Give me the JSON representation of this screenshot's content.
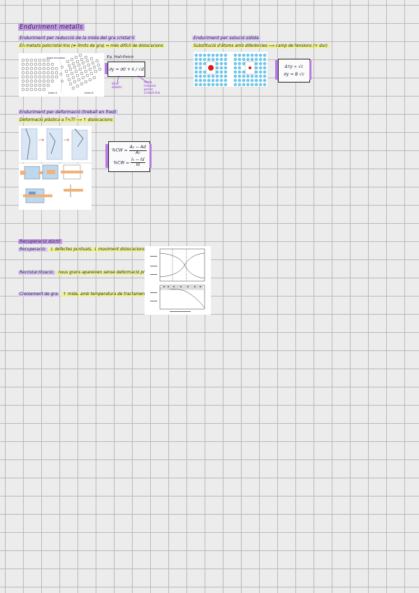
{
  "page": {
    "title": "Enduriment metalls"
  },
  "section1": {
    "heading": "Enduriment per reducció de la mida del gra cristal·lí",
    "subline": "En metalls policristal·lins (≠ límits de gra) ⇒ més difícil de dislocacions",
    "equation_label": "Eq. Hall-Petch",
    "equation": "σy = σ0 + k / √d",
    "note_left": "límit elàstic",
    "note_right": "mida mitjana grans cristal·lins",
    "figure_labels": {
      "top": "Grain boundary",
      "left": "Grain A",
      "right": "Grain B"
    }
  },
  "section2": {
    "heading": "Enduriment per solució sòlida",
    "subline": "Substitució d'àtoms amb diferències ⟶ camp de tensions (+ dur)",
    "formula1": "Δτy ∝ √c",
    "formula2": "σy = B √c"
  },
  "section3": {
    "heading": "Enduriment per deformació (treball en fred)",
    "subline": "Deformació plàstica a T<Tf ⟶ ↑ dislocacions",
    "cw1_lhs": "%CW =",
    "cw1_num": "A₀ − Ad",
    "cw1_den": "A₀",
    "cw2_lhs": "%CW =",
    "cw2_num": "l₀ − ld",
    "cw2_den": "ld"
  },
  "section4": {
    "heading": "Recuperació dúctil",
    "item1_label": "Recuperació:",
    "item1_text": "↓ defectes puntuals, ↓ moviment dislocacions",
    "item2_label": "Recristal·lització:",
    "item2_text": "nous grans apareixen sense deformació plàstica",
    "item3_label": "Creixement de gra:",
    "item3_text": "↑ mida, amb temperatura de tractament"
  },
  "colors": {
    "title_highlight": "#c59de6",
    "heading_highlight": "#d9c6f2",
    "subline_highlight": "#eef28a",
    "annotation": "#8a2bd6",
    "lattice_atom": "#6fc6ea",
    "solute_atom": "#d81b1b"
  }
}
